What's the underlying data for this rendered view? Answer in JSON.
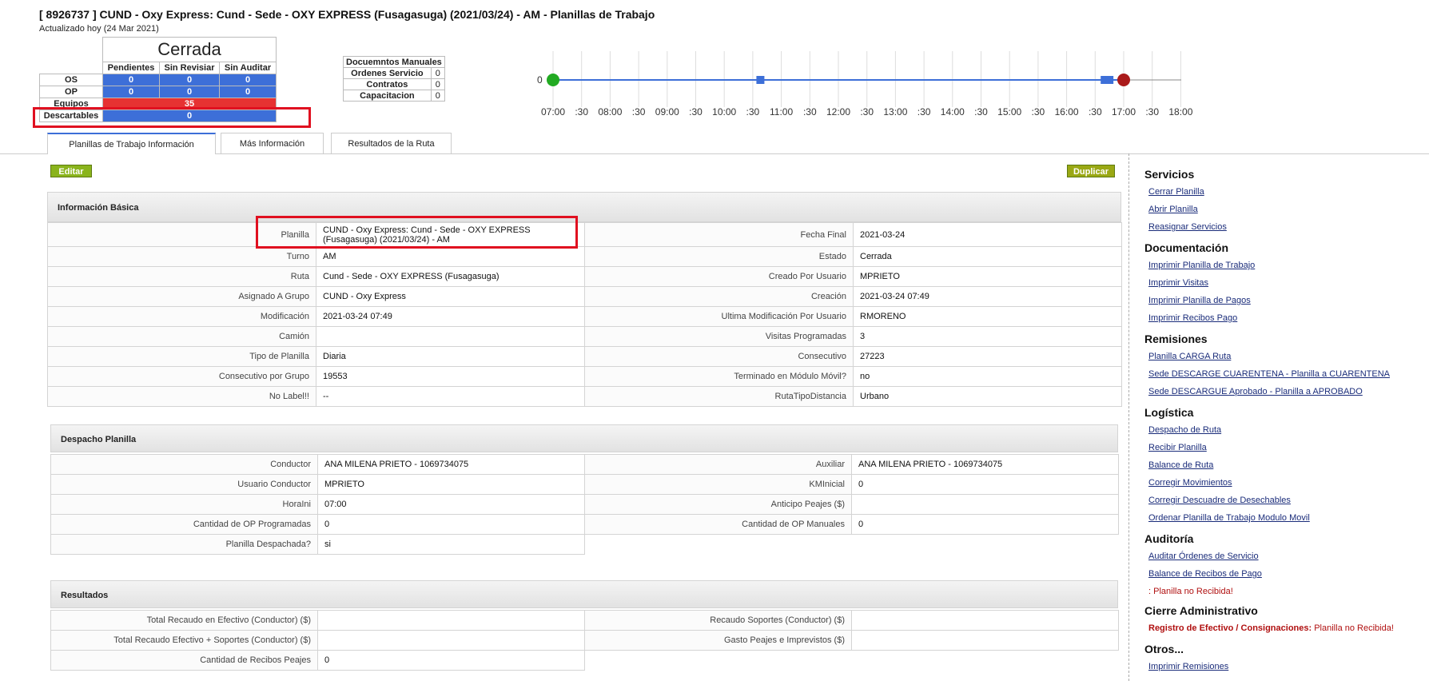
{
  "header": {
    "title": "[ 8926737 ] CUND - Oxy Express: Cund - Sede - OXY EXPRESS (Fusagasuga) (2021/03/24) - AM - Planillas de Trabajo",
    "updated": "Actualizado hoy (24 Mar 2021)"
  },
  "summary": {
    "status": "Cerrada",
    "columns": [
      "Pendientes",
      "Sin Revisiar",
      "Sin Auditar"
    ],
    "rows": [
      {
        "label": "OS",
        "values": [
          "0",
          "0",
          "0"
        ]
      },
      {
        "label": "OP",
        "values": [
          "0",
          "0",
          "0"
        ]
      }
    ],
    "equipos": {
      "label": "Equipos",
      "value": "35"
    },
    "descartables": {
      "label": "Descartables",
      "value": "0"
    }
  },
  "manual_docs": {
    "title": "Docuemntos Manuales",
    "rows": [
      {
        "label": "Ordenes Servicio",
        "value": "0"
      },
      {
        "label": "Contratos",
        "value": "0"
      },
      {
        "label": "Capacitacion",
        "value": "0"
      }
    ]
  },
  "timeline": {
    "start_label": "0",
    "ticks": [
      "07:00",
      ":30",
      "08:00",
      ":30",
      "09:00",
      ":30",
      "10:00",
      ":30",
      "11:00",
      ":30",
      "12:00",
      ":30",
      "13:00",
      ":30",
      "14:00",
      ":30",
      "15:00",
      ":30",
      "16:00",
      ":30",
      "17:00",
      ":30",
      "18:00"
    ],
    "markers": [
      {
        "type": "start",
        "time": "07:00",
        "color": "#22aa22"
      },
      {
        "type": "visit",
        "time": "10:38",
        "color": "#3d6fd8"
      },
      {
        "type": "visit",
        "time": "16:40",
        "color": "#3d6fd8"
      },
      {
        "type": "visit",
        "time": "16:45",
        "color": "#3d6fd8"
      },
      {
        "type": "end",
        "time": "17:00",
        "color": "#aa1a1a"
      }
    ]
  },
  "tabs": [
    {
      "label": "Planillas de Trabajo Información",
      "active": true
    },
    {
      "label": "Más Información",
      "active": false
    },
    {
      "label": "Resultados de la Ruta",
      "active": false
    }
  ],
  "buttons": {
    "edit": "Editar",
    "duplicate": "Duplicar"
  },
  "basic_info": {
    "title": "Información Básica",
    "rows": [
      [
        "Planilla",
        "CUND - Oxy Express: Cund - Sede - OXY EXPRESS (Fusagasuga) (2021/03/24) - AM",
        "Fecha Final",
        "2021-03-24"
      ],
      [
        "Turno",
        "AM",
        "Estado",
        "Cerrada"
      ],
      [
        "Ruta",
        "Cund - Sede - OXY EXPRESS (Fusagasuga)",
        "Creado Por Usuario",
        "MPRIETO"
      ],
      [
        "Asignado A Grupo",
        "CUND - Oxy Express",
        "Creación",
        "2021-03-24 07:49"
      ],
      [
        "Modificación",
        "2021-03-24 07:49",
        "Ultima Modificación Por Usuario",
        "RMORENO"
      ],
      [
        "Camión",
        "",
        "Visitas Programadas",
        "3"
      ],
      [
        "Tipo de Planilla",
        "Diaria",
        "Consecutivo",
        "27223"
      ],
      [
        "Consecutivo por Grupo",
        "19553",
        "Terminado en Módulo Móvil?",
        "no"
      ],
      [
        "No Label!!",
        "--",
        "RutaTipoDistancia",
        "Urbano"
      ]
    ]
  },
  "dispatch": {
    "title": "Despacho Planilla",
    "rows": [
      [
        "Conductor",
        "ANA MILENA PRIETO - 1069734075",
        "Auxiliar",
        "ANA MILENA PRIETO - 1069734075"
      ],
      [
        "Usuario Conductor",
        "MPRIETO",
        "KMInicial",
        "0"
      ],
      [
        "HoraIni",
        "07:00",
        "Anticipo Peajes ($)",
        ""
      ],
      [
        "Cantidad de OP Programadas",
        "0",
        "Cantidad de OP Manuales",
        "0"
      ],
      [
        "Planilla Despachada?",
        "si"
      ]
    ]
  },
  "results": {
    "title": "Resultados",
    "rows": [
      [
        "Total Recaudo en Efectivo (Conductor) ($)",
        "",
        "Recaudo Soportes (Conductor) ($)",
        ""
      ],
      [
        "Total Recaudo Efectivo + Soportes (Conductor) ($)",
        "",
        "Gasto Peajes e Imprevistos ($)",
        ""
      ],
      [
        "Cantidad de Recibos Peajes",
        "0"
      ]
    ]
  },
  "sidebar": {
    "servicios": {
      "title": "Servicios",
      "links": [
        "Cerrar Planilla",
        "Abrir Planilla",
        "Reasignar Servicios"
      ]
    },
    "documentacion": {
      "title": "Documentación",
      "links": [
        "Imprimir Planilla de Trabajo",
        "Imprimir Visitas",
        "Imprimir Planilla de Pagos",
        "Imprimir Recibos Pago"
      ]
    },
    "remisiones": {
      "title": "Remisiones",
      "links": [
        "Planilla CARGA Ruta",
        "Sede DESCARGE CUARENTENA - Planilla a CUARENTENA",
        "Sede DESCARGUE Aprobado - Planilla a APROBADO"
      ]
    },
    "logistica": {
      "title": "Logística",
      "links": [
        "Despacho de Ruta",
        "Recibir Planilla",
        "Balance de Ruta",
        "Corregir Movimientos",
        "Corregir Descuadre de Desechables",
        "Ordenar Planilla de Trabajo Modulo Movil"
      ]
    },
    "auditoria": {
      "title": "Auditoría",
      "links": [
        "Auditar Órdenes de Servicio",
        "Balance de Recibos de Pago"
      ],
      "note": ": Planilla no Recibida!"
    },
    "cierre": {
      "title": "Cierre Administrativo",
      "label": "Registro de Efectivo / Consignaciones:",
      "status": "Planilla no Recibida!"
    },
    "otros": {
      "title": "Otros...",
      "links": [
        "Imprimir Remisiones"
      ]
    }
  },
  "colors": {
    "accent_blue": "#3d6fd8",
    "red": "#e63232",
    "green_button": "#8ab41c",
    "highlight": "#e01020"
  }
}
